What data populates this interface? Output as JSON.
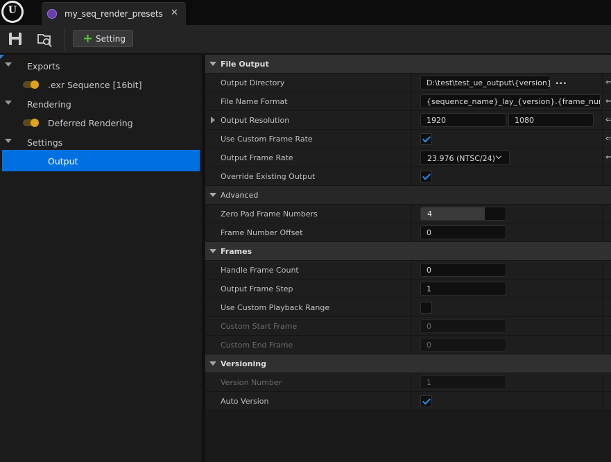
{
  "app": {
    "logo": "unreal-engine-logo",
    "logo_text": "U"
  },
  "tab": {
    "title": "my_seq_render_presets",
    "icon": "preset-asset-icon",
    "close_glyph": "✕"
  },
  "toolbar": {
    "save_icon": "save-icon",
    "browse_icon": "find-in-content-browser-icon",
    "setting_plus": "+",
    "setting_label": "Setting"
  },
  "tree": {
    "items": [
      {
        "label": "Exports",
        "type": "category"
      },
      {
        "label": ".exr Sequence [16bit]",
        "type": "setting",
        "enabled": true
      },
      {
        "label": "Rendering",
        "type": "category"
      },
      {
        "label": "Deferred Rendering",
        "type": "setting",
        "enabled": true
      },
      {
        "label": "Settings",
        "type": "category"
      },
      {
        "label": "Output",
        "type": "setting",
        "selected": true
      }
    ]
  },
  "details": {
    "reset_glyph": "⇐",
    "browse_glyph": "...",
    "file_output": {
      "header": "File Output",
      "output_directory": {
        "label": "Output Directory",
        "value": "D:\\test\\test_ue_output\\{version}"
      },
      "file_name_format": {
        "label": "File Name Format",
        "value": "{sequence_name}_lay_{version}.{frame_number}"
      },
      "output_resolution": {
        "label": "Output Resolution",
        "x": "1920",
        "y": "1080"
      },
      "use_custom_frame_rate": {
        "label": "Use Custom Frame Rate",
        "checked": true
      },
      "output_frame_rate": {
        "label": "Output Frame Rate",
        "value": "23.976 (NTSC/24)"
      },
      "override_existing_output": {
        "label": "Override Existing Output",
        "checked": true
      },
      "advanced": {
        "header": "Advanced",
        "zero_pad_frame_numbers": {
          "label": "Zero Pad Frame Numbers",
          "value": "4",
          "fill_fraction": 0.75
        },
        "frame_number_offset": {
          "label": "Frame Number Offset",
          "value": "0"
        }
      }
    },
    "frames": {
      "header": "Frames",
      "handle_frame_count": {
        "label": "Handle Frame Count",
        "value": "0"
      },
      "output_frame_step": {
        "label": "Output Frame Step",
        "value": "1"
      },
      "use_custom_playback_range": {
        "label": "Use Custom Playback Range",
        "checked": false
      },
      "custom_start_frame": {
        "label": "Custom Start Frame",
        "value": "0",
        "enabled": false
      },
      "custom_end_frame": {
        "label": "Custom End Frame",
        "value": "0",
        "enabled": false
      }
    },
    "versioning": {
      "header": "Versioning",
      "version_number": {
        "label": "Version Number",
        "value": "1",
        "enabled": false
      },
      "auto_version": {
        "label": "Auto Version",
        "checked": true
      }
    }
  },
  "colors": {
    "selection": "#0070e0",
    "toggle_on": "#e0a317",
    "checkmark": "#2a8ff0",
    "add_green": "#54c23a"
  }
}
